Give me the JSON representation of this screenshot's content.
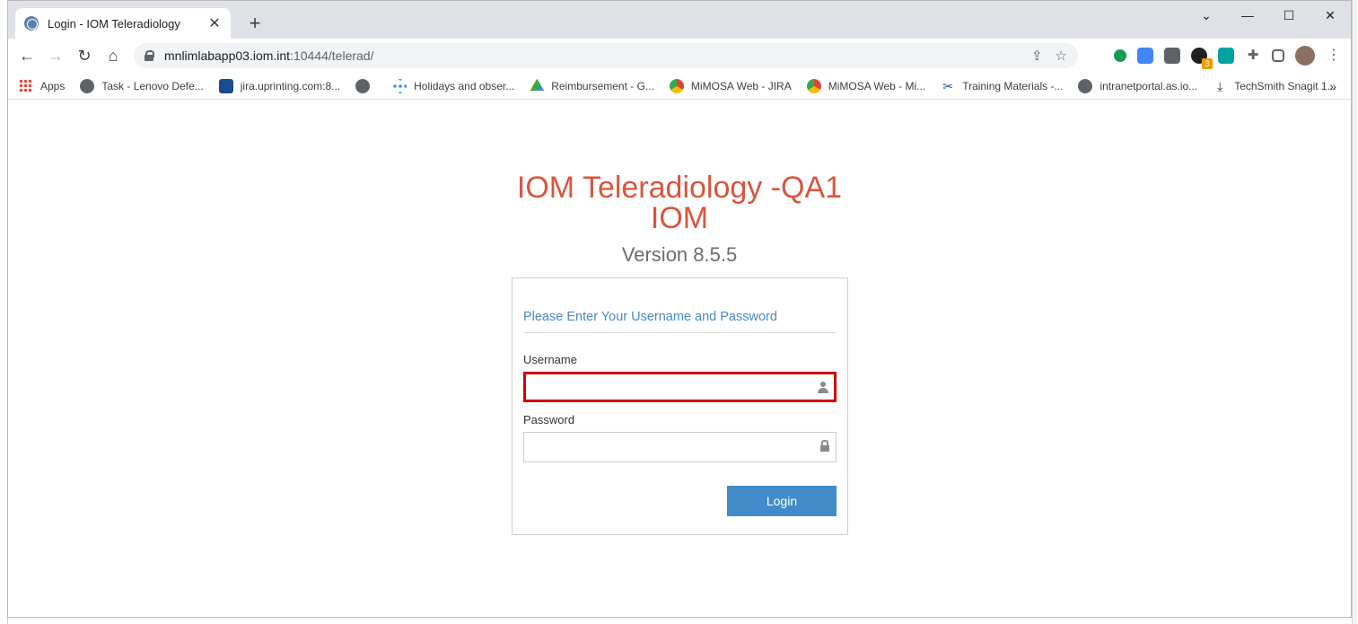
{
  "browser": {
    "tab_title": "Login - IOM Teleradiology",
    "tab_close": "✕",
    "new_tab": "+",
    "window_controls": {
      "chevron": "⌄",
      "minimize": "—",
      "maximize": "☐",
      "close": "✕"
    },
    "url_host": "mnlimlabapp03.iom.int",
    "url_path": ":10444/telerad/",
    "extension_badge": "3"
  },
  "bookmarks": [
    {
      "label": "Apps",
      "icon": "apps-grid-icon",
      "color": "#ea4335"
    },
    {
      "label": "Task - Lenovo Defe...",
      "icon": "globe-icon",
      "color": "#5f6368"
    },
    {
      "label": "jira.uprinting.com:8...",
      "icon": "jira-icon",
      "color": "#1a4b8c"
    },
    {
      "label": "",
      "icon": "globe-icon",
      "color": "#5f6368"
    },
    {
      "label": "Holidays and obser...",
      "icon": "dots-icon",
      "color": "#9aa0a6"
    },
    {
      "label": "Reimbursement - G...",
      "icon": "drive-icon",
      "color": "#34a853"
    },
    {
      "label": "MiMOSA Web - JIRA",
      "icon": "chrome-icon",
      "color": "#db4437"
    },
    {
      "label": "MiMOSA Web - Mi...",
      "icon": "chrome-icon",
      "color": "#db4437"
    },
    {
      "label": "Training Materials -...",
      "icon": "tools-icon",
      "color": "#1a4b8c"
    },
    {
      "label": "intranetportal.as.io...",
      "icon": "globe-icon",
      "color": "#5f6368"
    },
    {
      "label": "TechSmith Snagit 1...",
      "icon": "download-icon",
      "color": "#3c4043"
    }
  ],
  "bookmarks_more": "»",
  "page": {
    "title": "IOM Teleradiology -QA1",
    "subtitle": "IOM",
    "version": "Version 8.5.5"
  },
  "login": {
    "header": "Please Enter Your Username and Password",
    "username_label": "Username",
    "username_value": "",
    "password_label": "Password",
    "password_value": "",
    "button": "Login"
  }
}
